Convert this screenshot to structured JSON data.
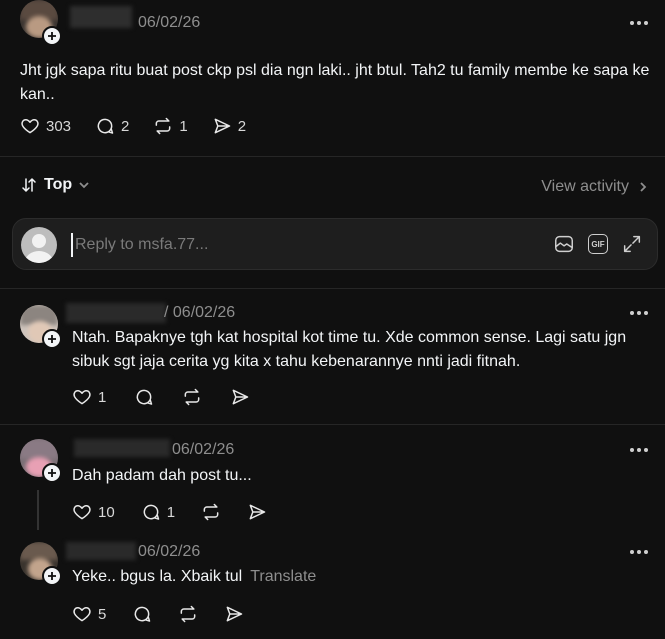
{
  "top_post": {
    "date": "06/02/26",
    "text": "Jht jgk sapa ritu buat post ckp psl dia ngn laki.. jht btul. Tah2 tu family membe ke sapa ke kan..",
    "likes": "303",
    "replies": "2",
    "reposts": "1",
    "shares": "2"
  },
  "sort": {
    "label": "Top"
  },
  "view_activity": "View activity",
  "reply_box": {
    "placeholder": "Reply to msfa.77...",
    "gif_label": "GIF"
  },
  "comments": [
    {
      "date": "/ 06/02/26",
      "text": "Ntah. Bapaknye tgh kat hospital kot time tu. Xde common sense. Lagi satu jgn sibuk sgt jaja cerita yg kita x tahu kebenarannye nnti jadi fitnah.",
      "likes": "1"
    },
    {
      "date": "06/02/26",
      "text": "Dah padam dah post tu...",
      "likes": "10",
      "replies": "1"
    },
    {
      "date": "06/02/26",
      "text": "Yeke.. bgus la. Xbaik tul",
      "translate": "Translate",
      "likes": "5"
    }
  ],
  "icons": {
    "like": "heart-icon",
    "reply": "comment-icon",
    "repost": "repost-icon",
    "share": "send-icon",
    "more": "more-icon"
  }
}
